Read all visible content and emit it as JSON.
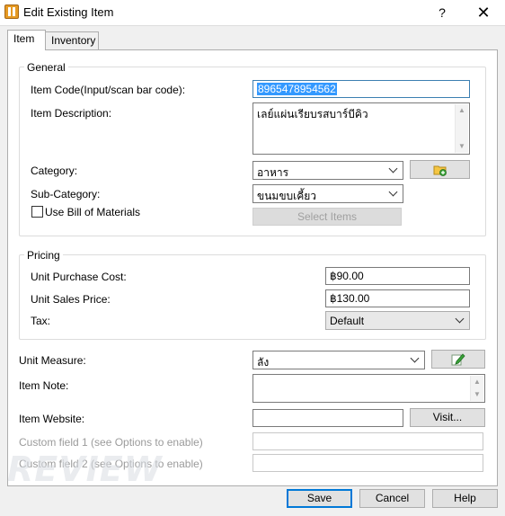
{
  "window": {
    "title": "Edit Existing Item",
    "help_glyph": "?",
    "close_glyph": "✕"
  },
  "tabs": [
    {
      "label": "Item"
    },
    {
      "label": "Inventory"
    }
  ],
  "general": {
    "legend": "General",
    "item_code_label": "Item Code(Input/scan bar code):",
    "item_code_value": "8965478954562",
    "item_description_label": "Item Description:",
    "item_description_value": "เลย์แผ่นเรียบรสบาร์บีคิว",
    "category_label": "Category:",
    "category_value": "อาหาร",
    "subcategory_label": "Sub-Category:",
    "subcategory_value": "ขนมขบเคี้ยว",
    "use_bom_label": "Use Bill of Materials",
    "use_bom_checked": false,
    "select_items_label": "Select Items"
  },
  "pricing": {
    "legend": "Pricing",
    "purchase_cost_label": "Unit Purchase Cost:",
    "purchase_cost_value": "฿90.00",
    "sales_price_label": "Unit Sales Price:",
    "sales_price_value": "฿130.00",
    "tax_label": "Tax:",
    "tax_value": "Default"
  },
  "other": {
    "unit_measure_label": "Unit Measure:",
    "unit_measure_value": "ลัง",
    "item_note_label": "Item Note:",
    "item_note_value": "",
    "item_website_label": "Item Website:",
    "item_website_value": "",
    "visit_label": "Visit...",
    "custom1_label": "Custom field 1 (see Options to enable)",
    "custom2_label": "Custom field 2 (see Options to enable)"
  },
  "footer": {
    "save_label": "Save",
    "cancel_label": "Cancel",
    "help_label": "Help"
  },
  "watermark": {
    "text": "REVIEW"
  },
  "colors": {
    "accent": "#0078d7",
    "selection": "#3399ff",
    "dialog_bg": "#f0f0f0"
  },
  "icons": {
    "category_add": "folder-add-icon",
    "unit_edit": "pencil-edit-icon"
  }
}
